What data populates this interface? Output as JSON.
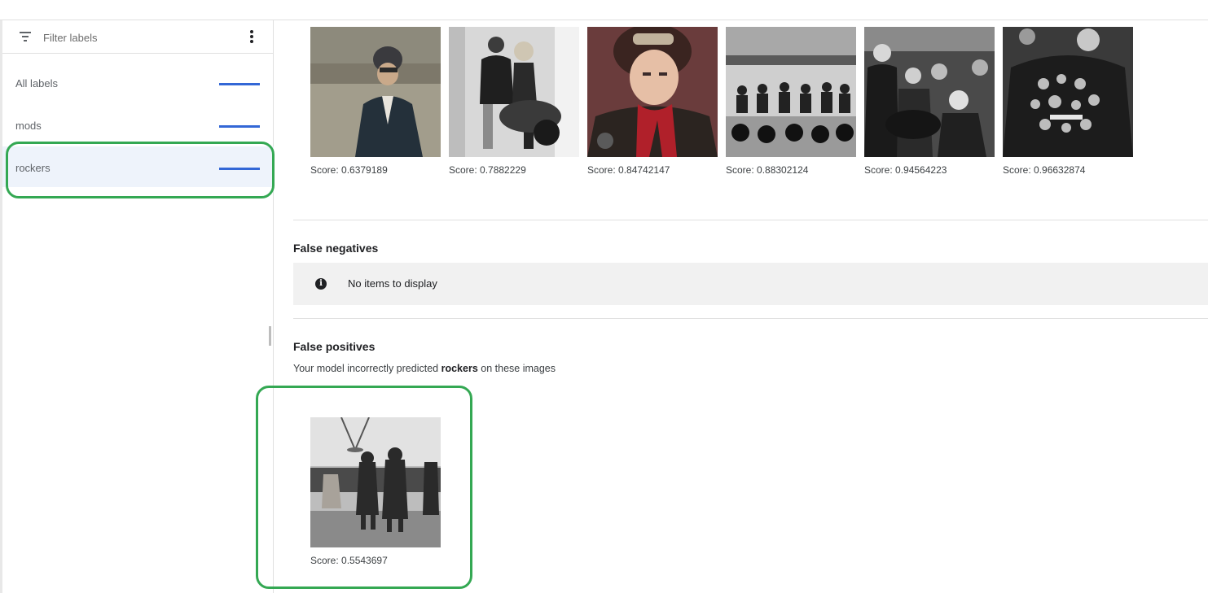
{
  "sidebar": {
    "filter_placeholder": "Filter labels",
    "items": [
      {
        "label": "All labels"
      },
      {
        "label": "mods"
      },
      {
        "label": "rockers",
        "selected": true
      }
    ]
  },
  "true_positives": {
    "images": [
      {
        "score": "Score: 0.6379189"
      },
      {
        "score": "Score: 0.7882229"
      },
      {
        "score": "Score: 0.84742147"
      },
      {
        "score": "Score: 0.88302124"
      },
      {
        "score": "Score: 0.94564223"
      },
      {
        "score": "Score: 0.96632874"
      }
    ]
  },
  "false_negatives": {
    "title": "False negatives",
    "empty_text": "No items to display"
  },
  "false_positives": {
    "title": "False positives",
    "desc_prefix": "Your model incorrectly predicted",
    "desc_label": "rockers",
    "desc_suffix": "on these images",
    "images": [
      {
        "score": "Score: 0.5543697"
      }
    ]
  },
  "colors": {
    "accent_bar": "#3367d6",
    "highlight_outline": "#34a853",
    "selected_bg": "#eef3fb"
  }
}
